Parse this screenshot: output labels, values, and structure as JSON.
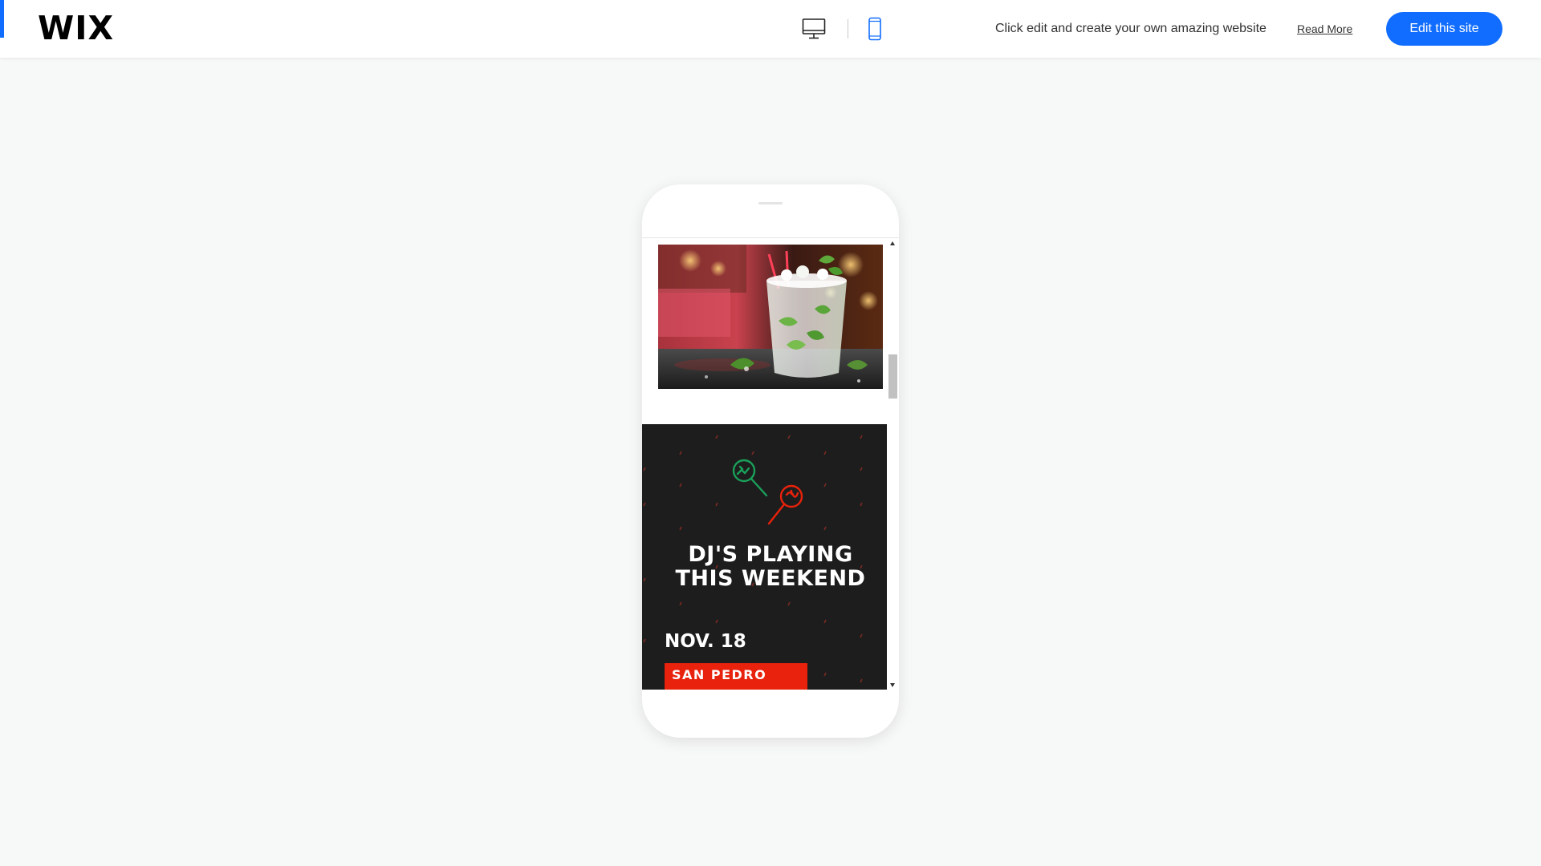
{
  "topbar": {
    "logo": "WIX",
    "promo_text": "Click edit and create your own amazing website",
    "read_more_label": "Read More",
    "edit_button_label": "Edit this site",
    "active_view": "mobile",
    "accent_color": "#116dff"
  },
  "mobile_preview": {
    "image_alt": "Mojito cocktail on a bar counter",
    "dj_section": {
      "title_line1": "DJ'S PLAYING",
      "title_line2": "THIS WEEKEND",
      "date": "NOV. 18",
      "location": "SAN PEDRO",
      "background_color": "#1d1d1d",
      "location_color": "#e8220c"
    }
  },
  "icons": {
    "desktop": "desktop-monitor-icon",
    "mobile": "mobile-phone-icon",
    "maracas": "maracas-icon"
  }
}
